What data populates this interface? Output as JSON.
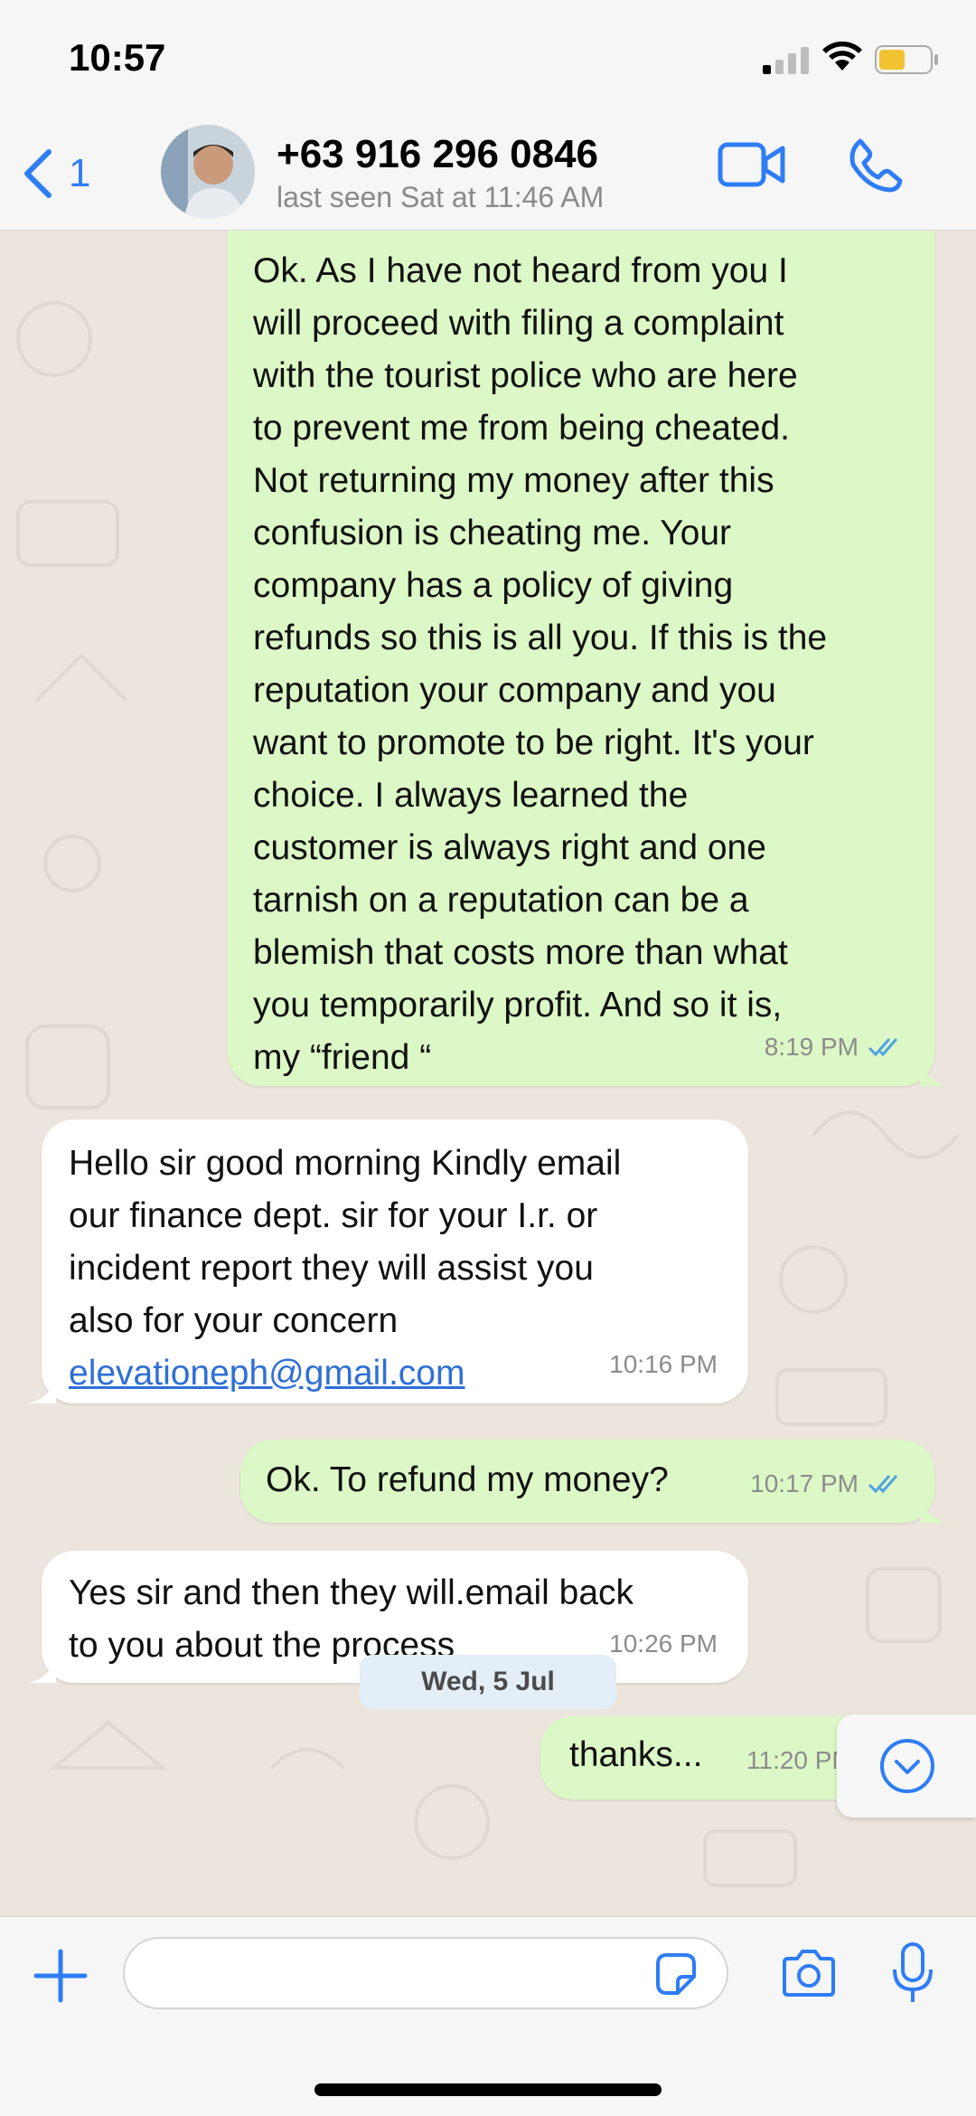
{
  "status_bar": {
    "time": "10:57"
  },
  "header": {
    "back_count": "1",
    "contact_name": "+63 916 296 0846",
    "last_seen": "last seen Sat at 11:46 AM"
  },
  "messages": [
    {
      "direction": "outgoing",
      "text": "Ok. As I have not heard from you I\nwill proceed with filing a complaint\nwith the tourist police who are here\nto prevent me from being cheated.\nNot returning my money after this\nconfusion is cheating me. Your\ncompany has a policy of giving\nrefunds so this is all you. If this is the\nreputation your company and you\nwant to promote to be right. It's your\nchoice. I always learned the\ncustomer is always right and one\ntarnish on a reputation can be a\nblemish that costs more than what\nyou temporarily profit. And so it is,\nmy “friend “",
      "time": "8:19 PM",
      "status": "read"
    },
    {
      "direction": "incoming",
      "text": "Hello sir good morning Kindly email\nour finance dept. sir for your I.r. or\nincident report they will assist you\nalso for your concern",
      "link": "elevationeph@gmail.com",
      "time": "10:16 PM"
    },
    {
      "direction": "outgoing",
      "text": "Ok. To refund my money?",
      "time": "10:17 PM",
      "status": "read"
    },
    {
      "direction": "incoming",
      "text": "Yes sir and then they will.email back\nto you about the process",
      "time": "10:26 PM"
    },
    {
      "direction": "outgoing",
      "text": "thanks...",
      "time": "11:20 PM"
    }
  ],
  "date_separator": "Wed, 5 Jul",
  "input": {
    "value": "",
    "placeholder": ""
  },
  "colors": {
    "accent": "#2f7df6",
    "outgoing_bubble": "#dcf8c6",
    "incoming_bubble": "#ffffff",
    "chat_background": "#ece5dd",
    "read_ticks": "#4fa3e0",
    "link": "#2f6fd6"
  },
  "icons": {
    "back": "chevron-left-icon",
    "video": "video-camera-icon",
    "call": "phone-icon",
    "scroll_down": "chevron-down-circle-icon",
    "attach": "plus-icon",
    "sticker": "sticker-icon",
    "camera": "camera-icon",
    "mic": "microphone-icon"
  }
}
